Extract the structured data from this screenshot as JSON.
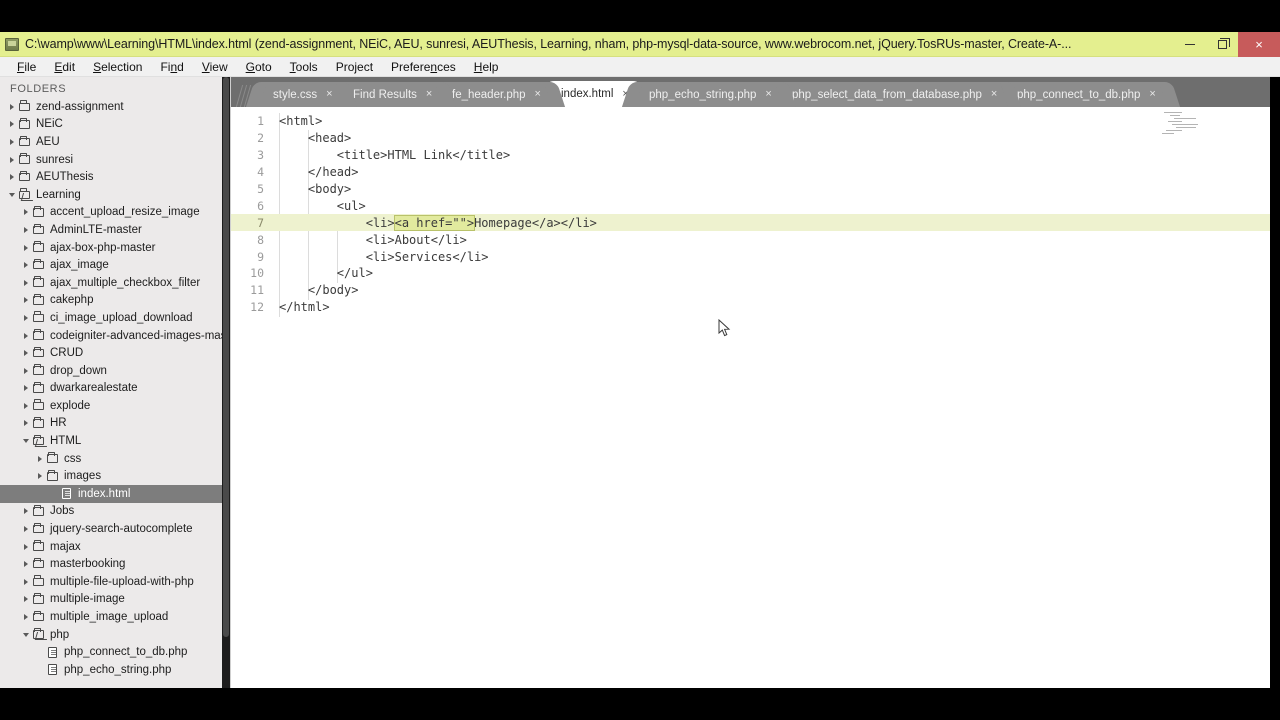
{
  "window": {
    "title": "C:\\wamp\\www\\Learning\\HTML\\index.html (zend-assignment, NEiC, AEU, sunresi, AEUThesis, Learning, nham, php-mysql-data-source, www.webrocom.net, jQuery.TosRUs-master, Create-A-...",
    "app_icon": "app-window-icon",
    "controls": {
      "minimize": "–",
      "maximize": "❐",
      "close": "×"
    },
    "titlebar_color": "#e4ef8f",
    "close_color": "#c75b5b"
  },
  "menubar": {
    "items": [
      {
        "label": "File",
        "accel": "F"
      },
      {
        "label": "Edit",
        "accel": "E"
      },
      {
        "label": "Selection",
        "accel": "S"
      },
      {
        "label": "Find",
        "accel": "n"
      },
      {
        "label": "View",
        "accel": "V"
      },
      {
        "label": "Goto",
        "accel": "G"
      },
      {
        "label": "Tools",
        "accel": "T"
      },
      {
        "label": "Project",
        "accel": ""
      },
      {
        "label": "Preferences",
        "accel": "n"
      },
      {
        "label": "Help",
        "accel": "H"
      }
    ]
  },
  "sidebar": {
    "header": "FOLDERS",
    "selected_color": "#7d7d7d",
    "items": [
      {
        "label": "zend-assignment",
        "type": "folder",
        "state": "collapsed",
        "depth": 0
      },
      {
        "label": "NEiC",
        "type": "folder",
        "state": "collapsed",
        "depth": 0
      },
      {
        "label": "AEU",
        "type": "folder",
        "state": "collapsed",
        "depth": 0
      },
      {
        "label": "sunresi",
        "type": "folder",
        "state": "collapsed",
        "depth": 0
      },
      {
        "label": "AEUThesis",
        "type": "folder",
        "state": "collapsed",
        "depth": 0
      },
      {
        "label": "Learning",
        "type": "folder",
        "state": "expanded",
        "depth": 0
      },
      {
        "label": "accent_upload_resize_image",
        "type": "folder",
        "state": "collapsed",
        "depth": 1
      },
      {
        "label": "AdminLTE-master",
        "type": "folder",
        "state": "collapsed",
        "depth": 1
      },
      {
        "label": "ajax-box-php-master",
        "type": "folder",
        "state": "collapsed",
        "depth": 1
      },
      {
        "label": "ajax_image",
        "type": "folder",
        "state": "collapsed",
        "depth": 1
      },
      {
        "label": "ajax_multiple_checkbox_filter",
        "type": "folder",
        "state": "collapsed",
        "depth": 1
      },
      {
        "label": "cakephp",
        "type": "folder",
        "state": "collapsed",
        "depth": 1
      },
      {
        "label": "ci_image_upload_download",
        "type": "folder",
        "state": "collapsed",
        "depth": 1
      },
      {
        "label": "codeigniter-advanced-images-maste",
        "type": "folder",
        "state": "collapsed",
        "depth": 1
      },
      {
        "label": "CRUD",
        "type": "folder",
        "state": "collapsed",
        "depth": 1
      },
      {
        "label": "drop_down",
        "type": "folder",
        "state": "collapsed",
        "depth": 1
      },
      {
        "label": "dwarkarealestate",
        "type": "folder",
        "state": "collapsed",
        "depth": 1
      },
      {
        "label": "explode",
        "type": "folder",
        "state": "collapsed",
        "depth": 1
      },
      {
        "label": "HR",
        "type": "folder",
        "state": "collapsed",
        "depth": 1
      },
      {
        "label": "HTML",
        "type": "folder",
        "state": "expanded",
        "depth": 1
      },
      {
        "label": "css",
        "type": "folder",
        "state": "collapsed",
        "depth": 2
      },
      {
        "label": "images",
        "type": "folder",
        "state": "collapsed",
        "depth": 2
      },
      {
        "label": "index.html",
        "type": "file",
        "state": "selected",
        "depth": 3
      },
      {
        "label": "Jobs",
        "type": "folder",
        "state": "collapsed",
        "depth": 1
      },
      {
        "label": "jquery-search-autocomplete",
        "type": "folder",
        "state": "collapsed",
        "depth": 1
      },
      {
        "label": "majax",
        "type": "folder",
        "state": "collapsed",
        "depth": 1
      },
      {
        "label": "masterbooking",
        "type": "folder",
        "state": "collapsed",
        "depth": 1
      },
      {
        "label": "multiple-file-upload-with-php",
        "type": "folder",
        "state": "collapsed",
        "depth": 1
      },
      {
        "label": "multiple-image",
        "type": "folder",
        "state": "collapsed",
        "depth": 1
      },
      {
        "label": "multiple_image_upload",
        "type": "folder",
        "state": "collapsed",
        "depth": 1
      },
      {
        "label": "php",
        "type": "folder",
        "state": "expanded",
        "depth": 1
      },
      {
        "label": "php_connect_to_db.php",
        "type": "file",
        "state": "normal",
        "depth": 2
      },
      {
        "label": "php_echo_string.php",
        "type": "file",
        "state": "normal",
        "depth": 2
      }
    ]
  },
  "tabs": {
    "close_glyph": "×",
    "items": [
      {
        "label": "style.css",
        "active": false
      },
      {
        "label": "Find Results",
        "active": false
      },
      {
        "label": "fe_header.php",
        "active": false
      },
      {
        "label": "index.html",
        "active": true
      },
      {
        "label": "php_echo_string.php",
        "active": false
      },
      {
        "label": "php_select_data_from_database.php",
        "active": false
      },
      {
        "label": "php_connect_to_db.php",
        "active": false
      }
    ]
  },
  "editor": {
    "highlight_line": 7,
    "highlight_color": "#eef2cf",
    "selection_color": "#e2ea9e",
    "lines": [
      {
        "num": "1",
        "pre": "<html>",
        "sel": "",
        "post": ""
      },
      {
        "num": "2",
        "pre": "    <head>",
        "sel": "",
        "post": ""
      },
      {
        "num": "3",
        "pre": "        <title>HTML Link</title>",
        "sel": "",
        "post": ""
      },
      {
        "num": "4",
        "pre": "    </head>",
        "sel": "",
        "post": ""
      },
      {
        "num": "5",
        "pre": "    <body>",
        "sel": "",
        "post": ""
      },
      {
        "num": "6",
        "pre": "        <ul>",
        "sel": "",
        "post": ""
      },
      {
        "num": "7",
        "pre": "            <li>",
        "sel": "<a href=\"\">",
        "post": "Homepage</a></li>"
      },
      {
        "num": "8",
        "pre": "            <li>About</li>",
        "sel": "",
        "post": ""
      },
      {
        "num": "9",
        "pre": "            <li>Services</li>",
        "sel": "",
        "post": ""
      },
      {
        "num": "10",
        "pre": "        </ul>",
        "sel": "",
        "post": ""
      },
      {
        "num": "11",
        "pre": "    </body>",
        "sel": "",
        "post": ""
      },
      {
        "num": "12",
        "pre": "</html>",
        "sel": "",
        "post": ""
      }
    ]
  }
}
